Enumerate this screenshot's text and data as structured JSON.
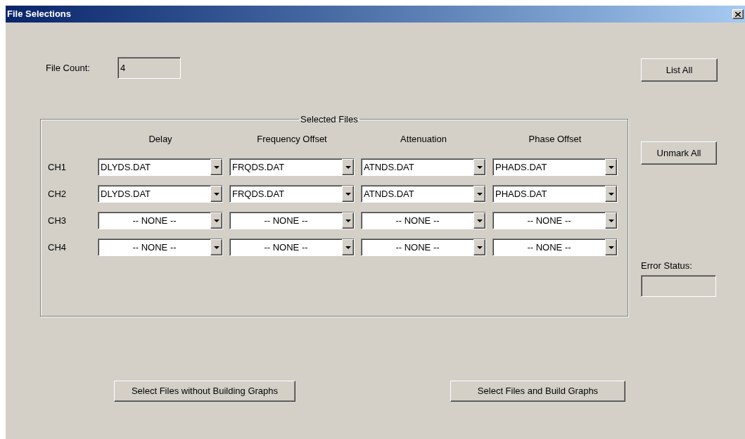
{
  "window": {
    "title": "File Selections"
  },
  "file_count": {
    "label": "File Count:",
    "value": "4"
  },
  "list_all_button": "List All",
  "unmark_all_button": "Unmark All",
  "error_status": {
    "label": "Error Status:"
  },
  "selected_files": {
    "title": "Selected Files",
    "columns": [
      "Delay",
      "Frequency Offset",
      "Attenuation",
      "Phase Offset"
    ],
    "rows": [
      {
        "channel": "CH1",
        "files": [
          {
            "kind": "file",
            "value": "DLYDS.DAT"
          },
          {
            "kind": "file",
            "value": "FRQDS.DAT"
          },
          {
            "kind": "file",
            "value": "ATNDS.DAT"
          },
          {
            "kind": "file",
            "value": "PHADS.DAT"
          }
        ]
      },
      {
        "channel": "CH2",
        "files": [
          {
            "kind": "file",
            "value": "DLYDS.DAT"
          },
          {
            "kind": "file",
            "value": "FRQDS.DAT"
          },
          {
            "kind": "file",
            "value": "ATNDS.DAT"
          },
          {
            "kind": "file",
            "value": "PHADS.DAT"
          }
        ]
      },
      {
        "channel": "CH3",
        "files": [
          {
            "kind": "none",
            "value": "-- NONE --"
          },
          {
            "kind": "none",
            "value": "-- NONE --"
          },
          {
            "kind": "none",
            "value": "-- NONE --"
          },
          {
            "kind": "none",
            "value": "-- NONE --"
          }
        ]
      },
      {
        "channel": "CH4",
        "files": [
          {
            "kind": "none",
            "value": "-- NONE --"
          },
          {
            "kind": "none",
            "value": "-- NONE --"
          },
          {
            "kind": "none",
            "value": "-- NONE --"
          },
          {
            "kind": "none",
            "value": "-- NONE --"
          }
        ]
      }
    ]
  },
  "bottom_buttons": [
    "Select Files without Building Graphs",
    "Select Files and Build Graphs"
  ]
}
